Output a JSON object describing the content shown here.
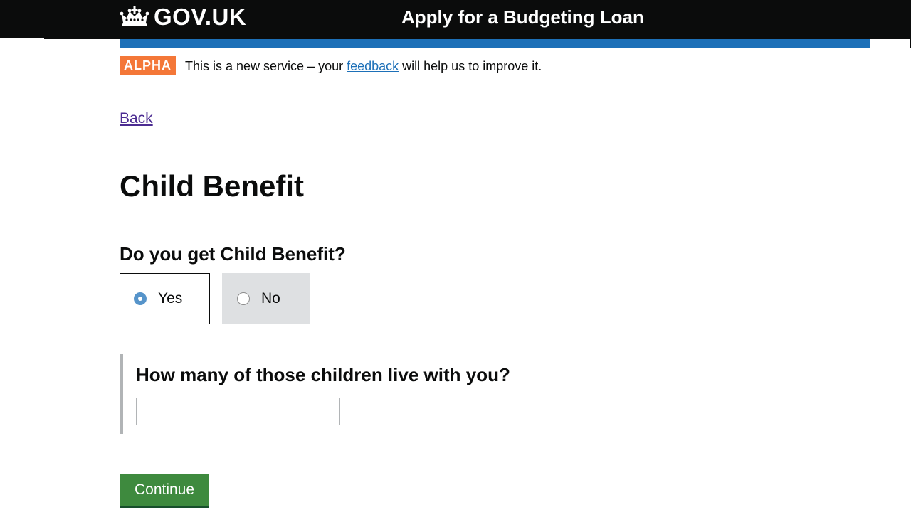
{
  "header": {
    "logo_text": "GOV.UK",
    "service_name": "Apply for a Budgeting Loan",
    "logo_icon": "crown-icon"
  },
  "phase_banner": {
    "tag": "ALPHA",
    "text_before": "This is a new service – your ",
    "link_text": "feedback",
    "text_after": " will help us to improve it."
  },
  "back_link": "Back",
  "page_title": "Child Benefit",
  "question": "Do you get Child Benefit?",
  "radios": [
    {
      "label": "Yes",
      "checked": true
    },
    {
      "label": "No",
      "checked": false
    }
  ],
  "conditional": {
    "question": "How many of those children live with you?",
    "input_value": ""
  },
  "continue_label": "Continue",
  "colors": {
    "header_bg": "#0b0c0c",
    "rule_blue": "#1d70b8",
    "alpha_tag": "#f47738",
    "link": "#1d70b8",
    "back_link": "#4c2c92",
    "button_green": "#3e8a3e",
    "radio_selected": "#5694ca"
  }
}
